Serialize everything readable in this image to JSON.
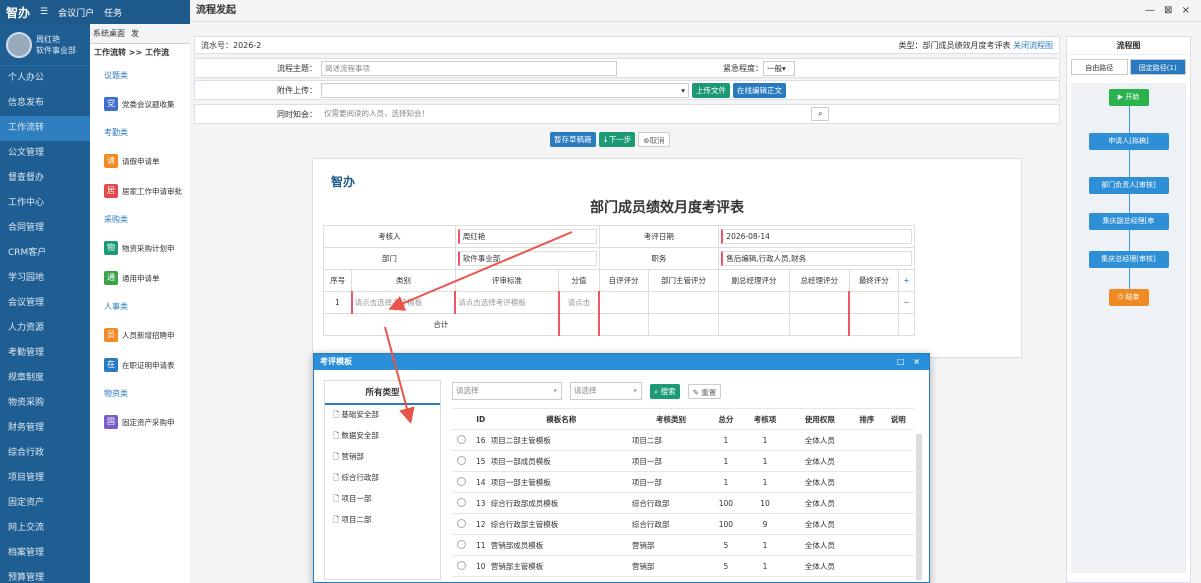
{
  "app": {
    "logo": "智办",
    "menu_top": [
      "会议门户",
      "任务"
    ]
  },
  "user": {
    "name": "周红艳",
    "dept": "软件事业部"
  },
  "sidebar": {
    "items": [
      "个人办公",
      "信息发布",
      "工作流转",
      "公文管理",
      "督查督办",
      "工作中心",
      "合同管理",
      "CRM客户",
      "学习园地",
      "会议管理",
      "人力资源",
      "考勤管理",
      "规章制度",
      "物资采购",
      "财务管理",
      "综合行政",
      "项目管理",
      "固定资产",
      "网上交流",
      "档案管理",
      "预算管理"
    ],
    "active_index": 2
  },
  "tabs": [
    "系统桌面",
    "发"
  ],
  "module": {
    "breadcrumb": "工作流转 >> 工作流",
    "sections": [
      {
        "title": "议题类",
        "items": [
          {
            "icon": "党",
            "label": "党委会议题收集",
            "color": "#3b6fc9"
          }
        ]
      },
      {
        "title": "考勤类",
        "items": [
          {
            "icon": "请",
            "label": "请假申请单",
            "color": "#f08a24"
          },
          {
            "icon": "居",
            "label": "居家工作申请审批",
            "color": "#e24a4a"
          }
        ]
      },
      {
        "title": "采购类",
        "items": [
          {
            "icon": "物",
            "label": "物资采购计划申",
            "color": "#1b9a75"
          },
          {
            "icon": "通",
            "label": "通用申请单",
            "color": "#3aa34a"
          }
        ]
      },
      {
        "title": "人事类",
        "items": [
          {
            "icon": "员",
            "label": "人员新增招聘申",
            "color": "#f08a24"
          },
          {
            "icon": "在",
            "label": "在职证明申请表",
            "color": "#2a7ac0"
          }
        ]
      },
      {
        "title": "物资类",
        "items": [
          {
            "icon": "固",
            "label": "固定资产采购申",
            "color": "#7a5cc9"
          }
        ]
      }
    ]
  },
  "dialog": {
    "title": "流程发起",
    "controls": "— ⊠ ×",
    "flow_no": "流水号：2026-2",
    "type_text": "类型：部门成员绩效月度考评表",
    "close_flowchart": "关闭流程图",
    "subject_label": "流程主题：",
    "subject_placeholder": "简述流程事项",
    "urgency_label": "紧急程度：",
    "urgency_value": "一般",
    "attachment_label": "附件上传：",
    "upload_btn": "上传文件",
    "online_edit_btn": "在线编辑正文",
    "notify_label": "同时知会：",
    "notify_placeholder": "仅需要阅读的人员，选择知会！",
    "save_draft_btn": "暂存草稿箱",
    "next_btn": "↓下一步",
    "cancel_btn": "⊗取消"
  },
  "right_panel": {
    "title": "流程图",
    "btn_free": "自由路径",
    "btn_fixed": "固定路径(1)",
    "nodes": [
      "▶ 开始",
      "申请人[拟稿]",
      "部门负责人[审核]",
      "集庆副总经理[审",
      "集庆总经理[审核]",
      "⏻ 结束"
    ]
  },
  "form": {
    "logo": "智办",
    "title": "部门成员绩效月度考评表",
    "reviewer_label": "考核人",
    "reviewer": "周红艳",
    "date_label": "考评日期",
    "date": "2026-08-14",
    "dept_label": "部门",
    "dept": "软件事业部",
    "position_label": "职务",
    "position": "售后编辑,行政人员,财务",
    "columns": [
      "序号",
      "类别",
      "评审标准",
      "分值",
      "自评评分",
      "部门主管评分",
      "副总经理评分",
      "总经理评分",
      "最终评分",
      "+"
    ],
    "row1": {
      "no": "1",
      "category": "请点击选择考评模板",
      "standard": "请点击选择考评模板",
      "score": "请点击"
    },
    "total_label": "合计"
  },
  "modal": {
    "title": "考评模板",
    "controls": "□ ×",
    "tree_title": "所有类型",
    "tree_items": [
      "基础安全部",
      "数据安全部",
      "营销部",
      "综合行政部",
      "项目一部",
      "项目二部"
    ],
    "select_placeholder_1": "请选择",
    "select_placeholder_2": "请选择",
    "search_btn": "搜索",
    "reset_btn": "重置",
    "columns": [
      "ID",
      "模板名称",
      "考核类别",
      "总分",
      "考核项",
      "使用权限",
      "排序",
      "说明"
    ],
    "rows": [
      [
        "16",
        "项目二部主管模板",
        "项目二部",
        "1",
        "1",
        "全体人员"
      ],
      [
        "15",
        "项目一部成员模板",
        "项目一部",
        "1",
        "1",
        "全体人员"
      ],
      [
        "14",
        "项目一部主管模板",
        "项目一部",
        "1",
        "1",
        "全体人员"
      ],
      [
        "13",
        "综合行政部成员模板",
        "综合行政部",
        "100",
        "10",
        "全体人员"
      ],
      [
        "12",
        "综合行政部主管模板",
        "综合行政部",
        "100",
        "9",
        "全体人员"
      ],
      [
        "11",
        "营销部成员模板",
        "营销部",
        "5",
        "1",
        "全体人员"
      ],
      [
        "10",
        "营销部主管模板",
        "营销部",
        "5",
        "1",
        "全体人员"
      ]
    ]
  },
  "colors": {
    "primary": "#2a7ac0",
    "sidebar": "#1f5e92",
    "green": "#1b9a75",
    "arrow": "#e8534a",
    "flow_node": "#2f8fd6",
    "flow_start": "#2bb24c",
    "flow_end": "#f08a24"
  }
}
